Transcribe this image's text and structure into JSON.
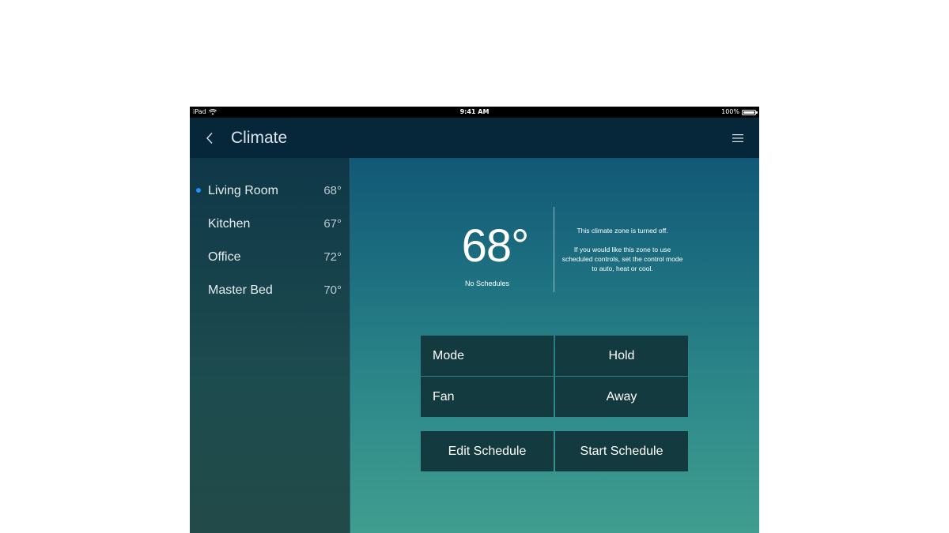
{
  "statusbar": {
    "device": "iPad",
    "time": "9:41 AM",
    "battery": "100%"
  },
  "navbar": {
    "title": "Climate",
    "back_icon": "chevron-left-icon",
    "menu_icon": "hamburger-menu-icon"
  },
  "zones": [
    {
      "name": "Living Room",
      "temp": "68°",
      "active": true
    },
    {
      "name": "Kitchen",
      "temp": "67°",
      "active": false
    },
    {
      "name": "Office",
      "temp": "72°",
      "active": false
    },
    {
      "name": "Master Bed",
      "temp": "70°",
      "active": false
    }
  ],
  "main": {
    "temperature": "68°",
    "schedules_label": "No Schedules",
    "off_message": "This climate zone is turned off.",
    "off_hint": "If you would like this zone to use scheduled controls, set the control mode to auto, heat or cool."
  },
  "controls": {
    "mode": "Mode",
    "hold": "Hold",
    "fan": "Fan",
    "away": "Away",
    "edit_schedule": "Edit Schedule",
    "start_schedule": "Start Schedule"
  },
  "colors": {
    "active_dot": "#1f8fff",
    "navbar": "#06273a",
    "button_bg": "#133a3e"
  }
}
